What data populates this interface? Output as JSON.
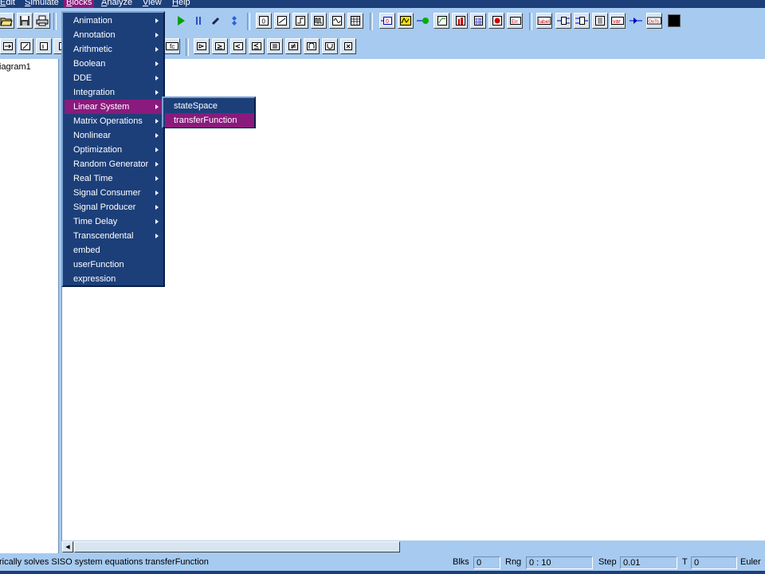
{
  "menubar": {
    "items": [
      {
        "label": "Edit",
        "u": "E",
        "rest": "dit"
      },
      {
        "label": "Simulate",
        "u": "S",
        "rest": "imulate"
      },
      {
        "label": "Blocks",
        "u": "B",
        "rest": "locks",
        "active": true
      },
      {
        "label": "Analyze",
        "u": "A",
        "rest": "nalyze"
      },
      {
        "label": "View",
        "u": "V",
        "rest": "iew"
      },
      {
        "label": "Help",
        "u": "H",
        "rest": "elp"
      }
    ]
  },
  "toolbar1": {
    "left_icons": [
      "open-folder-icon",
      "save-disk-icon",
      "print-icon"
    ],
    "sim_icons": [
      "play-icon",
      "pause-icon",
      "step-icon",
      "reset-icon"
    ],
    "block_icons_a": [
      "const-block-icon",
      "ramp-block-icon",
      "step-block-icon",
      "pulse-block-icon",
      "sine-block-icon",
      "table-block-icon"
    ],
    "block_icons_b": [
      "gain-icon",
      "scope-icon",
      "dot-icon",
      "xy-plot-icon",
      "bar-plot-icon",
      "grid-icon",
      "stop-icon",
      "error-icon"
    ],
    "block_icons_c": [
      "label-icon",
      "split-icon",
      "merge-icon",
      "matrix-icon",
      "variable-icon",
      "arrow-icon",
      "oots-icon",
      "black-square-icon"
    ],
    "labels": {
      "const": "0",
      "label": "label",
      "err": "Err",
      "var": "var",
      "oots": "OoTs"
    }
  },
  "toolbar2": {
    "left_icons": [
      "connect-block-icon",
      "integrator-block-icon",
      "delay-block-icon",
      "transfer-block-icon"
    ],
    "fc_label": "fc",
    "right_icons": [
      "buffer-block-icon",
      "compare-block-icon",
      "mux-block-icon",
      "demux-block-icon",
      "sum-block-icon",
      "logic-block-icon",
      "memory-block-icon",
      "unit-delay-block-icon",
      "cross-block-icon"
    ]
  },
  "tree": {
    "item": "iagram1"
  },
  "blocks_menu": {
    "items": [
      {
        "label": "Animation",
        "sub": true
      },
      {
        "label": "Annotation",
        "sub": true
      },
      {
        "label": "Arithmetic",
        "sub": true
      },
      {
        "label": "Boolean",
        "sub": true
      },
      {
        "label": "DDE",
        "sub": true
      },
      {
        "label": "Integration",
        "sub": true
      },
      {
        "label": "Linear System",
        "sub": true,
        "hl": true
      },
      {
        "label": "Matrix Operations",
        "sub": true
      },
      {
        "label": "Nonlinear",
        "sub": true
      },
      {
        "label": "Optimization",
        "sub": true
      },
      {
        "label": "Random Generator",
        "sub": true
      },
      {
        "label": "Real Time",
        "sub": true
      },
      {
        "label": "Signal Consumer",
        "sub": true
      },
      {
        "label": "Signal Producer",
        "sub": true
      },
      {
        "label": "Time Delay",
        "sub": true
      },
      {
        "label": "Transcendental",
        "sub": true
      },
      {
        "label": "embed",
        "sub": false
      },
      {
        "label": "userFunction",
        "sub": false
      },
      {
        "label": "expression",
        "sub": false
      }
    ]
  },
  "linear_submenu": {
    "items": [
      {
        "label": "stateSpace",
        "hl": false
      },
      {
        "label": "transferFunction",
        "hl": true
      }
    ]
  },
  "status": {
    "message": "rically solves SISO system equations transferFunction",
    "blks_label": "Blks",
    "blks_value": "0",
    "rng_label": "Rng",
    "rng_value": "0 : 10",
    "step_label": "Step",
    "step_value": "0.01",
    "t_label": "T",
    "t_value": "0",
    "method": "Euler"
  },
  "colors": {
    "menu_bg": "#1c3f7a",
    "highlight": "#8a1a7d",
    "chrome": "#a6caf0"
  }
}
